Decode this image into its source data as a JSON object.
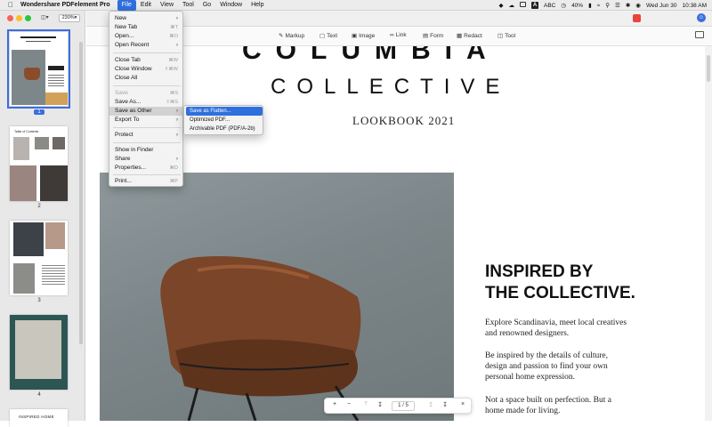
{
  "menubar": {
    "app_name": "Wondershare PDFelement Pro",
    "items": [
      "File",
      "Edit",
      "View",
      "Tool",
      "Go",
      "Window",
      "Help"
    ],
    "status": {
      "input_source": "ABC",
      "battery": "40%",
      "datetime": "Wed Jun 30",
      "time": "10:38 AM"
    }
  },
  "sidebar": {
    "zoom": "230%",
    "pages": [
      "1",
      "2",
      "3",
      "4"
    ],
    "thumb2_title": "Table of Contents",
    "thumb5_title": "INSPIRED HOME"
  },
  "toolbar": {
    "tools": [
      "Markup",
      "Text",
      "Image",
      "Link",
      "Form",
      "Redact",
      "Tool"
    ]
  },
  "document": {
    "title1": "COLUMBIA",
    "title2": "COLLECTIVE",
    "subtitle": "LOOKBOOK 2021",
    "heading_line1": "INSPIRED BY",
    "heading_line2": "THE COLLECTIVE.",
    "para1_line1": "Explore Scandinavia, meet local creatives",
    "para1_line2": "and renowned designers.",
    "para2_line1": "Be inspired by the details of culture,",
    "para2_line2": "design and passion to find your own",
    "para2_line3": "personal home expression.",
    "para3_line1": "Not a space built on perfection. But a",
    "para3_line2": "home made for living."
  },
  "file_menu": {
    "items": [
      {
        "label": "New",
        "shortcut": "",
        "arrow": true
      },
      {
        "label": "New Tab",
        "shortcut": "⌘T"
      },
      {
        "label": "Open...",
        "shortcut": "⌘O"
      },
      {
        "label": "Open Recent",
        "shortcut": "",
        "arrow": true
      },
      {
        "label": "Close Tab",
        "shortcut": "⌘W"
      },
      {
        "label": "Close Window",
        "shortcut": "⇧⌘W"
      },
      {
        "label": "Close All",
        "shortcut": ""
      },
      {
        "label": "Save",
        "shortcut": "⌘S",
        "disabled": true
      },
      {
        "label": "Save As...",
        "shortcut": "⇧⌘S"
      },
      {
        "label": "Save as Other",
        "shortcut": "",
        "arrow": true
      },
      {
        "label": "Export To",
        "shortcut": "",
        "arrow": true
      },
      {
        "label": "Protect",
        "shortcut": "",
        "arrow": true
      },
      {
        "label": "Show in Finder",
        "shortcut": ""
      },
      {
        "label": "Share",
        "shortcut": "",
        "arrow": true
      },
      {
        "label": "Properties...",
        "shortcut": "⌘D"
      },
      {
        "label": "Print...",
        "shortcut": "⌘P"
      }
    ]
  },
  "save_as_other_submenu": {
    "items": [
      "Save as Flatten...",
      "Optimized PDF...",
      "Archivable PDF (PDF/A-2b)"
    ]
  },
  "page_nav": {
    "current": "1",
    "total": "5",
    "separator": "/"
  }
}
